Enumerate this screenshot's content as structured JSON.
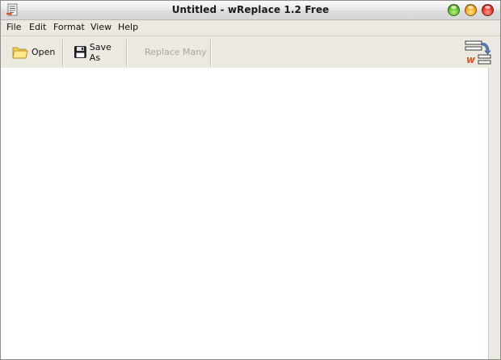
{
  "window": {
    "title": "Untitled - wReplace 1.2 Free"
  },
  "menu": {
    "items": [
      "File",
      "Edit",
      "Format",
      "View",
      "Help"
    ]
  },
  "toolbar": {
    "open_label": "Open",
    "save_as_label": "Save As",
    "replace_many_label": "Replace Many",
    "replace_many_enabled": false,
    "logo_letter": "w"
  },
  "editor": {
    "content": ""
  },
  "icons": {
    "app": "text-document-icon",
    "open": "folder-icon",
    "save": "floppy-disk-icon",
    "logo": "wreplace-logo-icon"
  }
}
